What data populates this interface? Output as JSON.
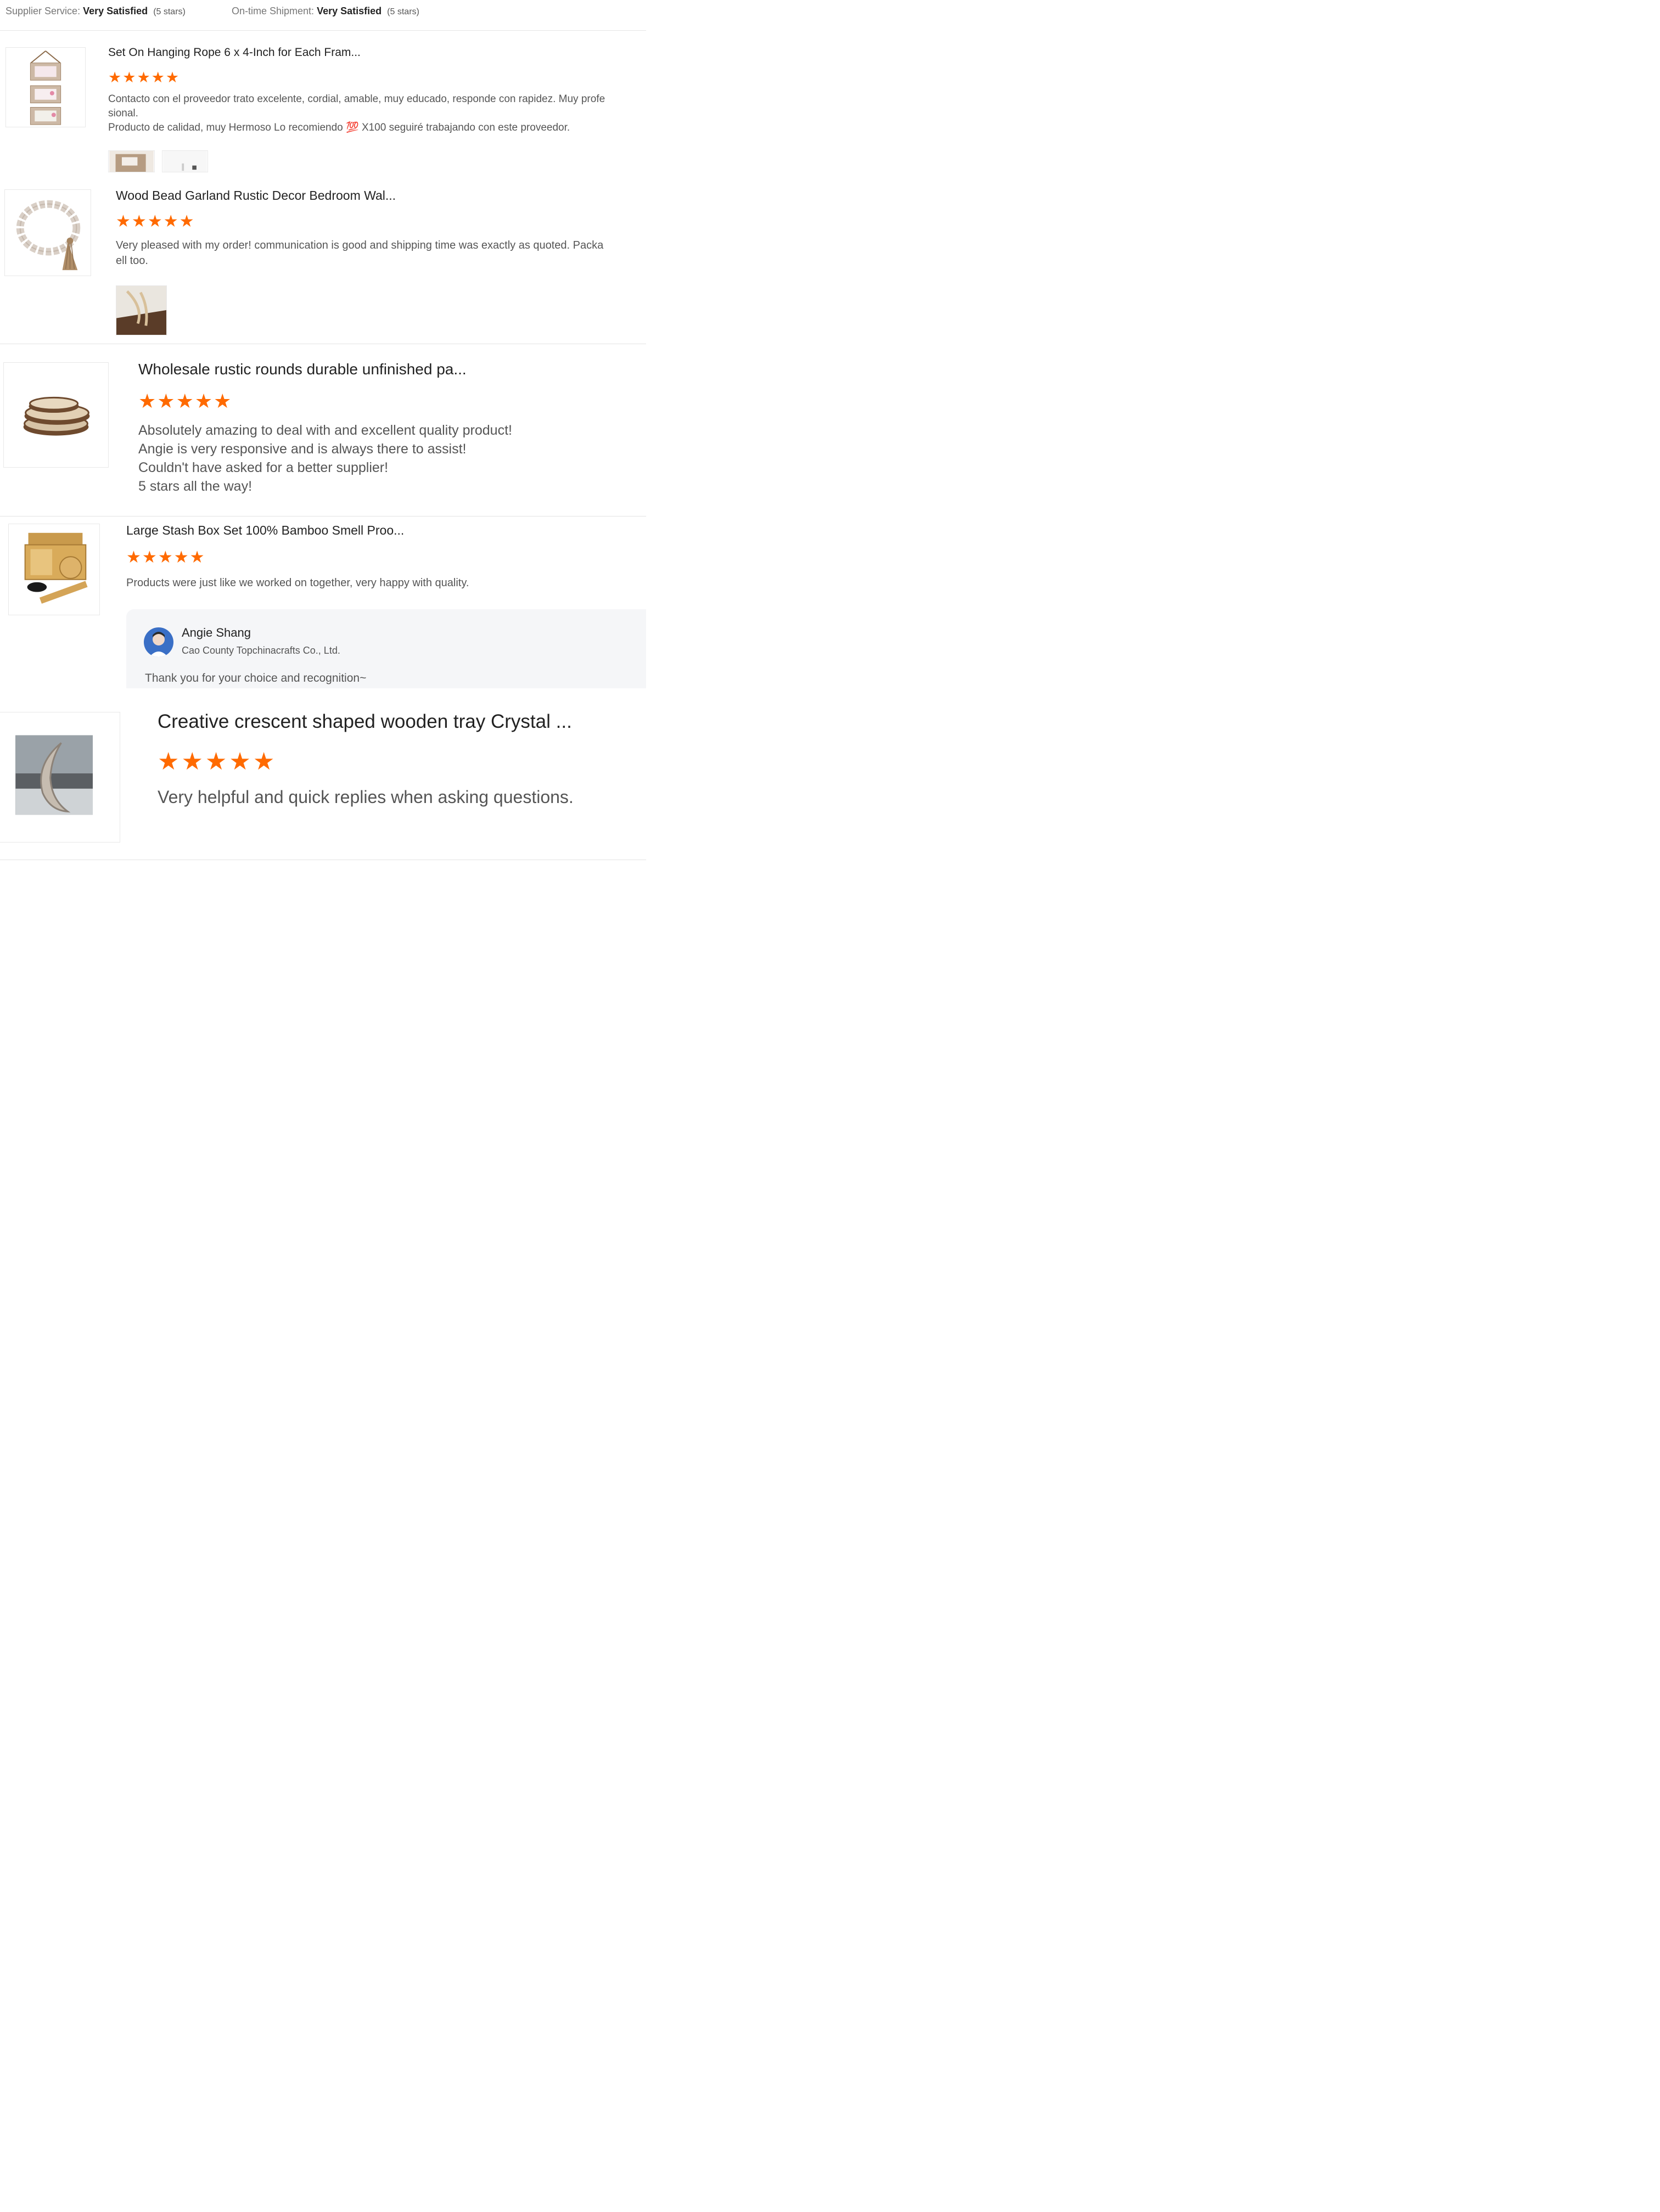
{
  "header": {
    "supplier_service": {
      "label": "Supplier Service:",
      "value": "Very Satisfied",
      "count": "(5 stars)"
    },
    "on_time_shipment": {
      "label": "On-time Shipment:",
      "value": "Very Satisfied",
      "count": "(5 stars)"
    }
  },
  "reviews": [
    {
      "product_title": "Set On Hanging Rope 6 x 4-Inch for Each Fram...",
      "rating": 5,
      "text_lines": [
        "Contacto con el proveedor trato excelente, cordial, amable, muy educado, responde con rapidez. Muy profe",
        "sional.",
        "Producto de calidad, muy Hermoso Lo recomiendo 💯 X100   seguiré trabajando con este proveedor."
      ],
      "photos": 2
    },
    {
      "product_title": "Wood Bead Garland Rustic Decor Bedroom Wal...",
      "rating": 5,
      "text_lines": [
        "Very pleased with my order! communication is good and shipping time was exactly as quoted. Packa",
        "ell too."
      ],
      "photos": 1
    },
    {
      "product_title": "Wholesale rustic rounds durable unfinished pa...",
      "rating": 5,
      "text_lines": [
        "Absolutely amazing to deal with and excellent quality product!",
        "Angie is very responsive and is always there to assist!",
        "Couldn't have asked for a better supplier!",
        "5 stars all the way!"
      ]
    },
    {
      "product_title": "Large Stash Box Set 100% Bamboo Smell Proo...",
      "rating": 5,
      "text_lines": [
        "Products were just like we worked on together, very happy with quality."
      ],
      "reply": {
        "name": "Angie Shang",
        "company": "Cao County Topchinacrafts Co., Ltd.",
        "message": "Thank you for your choice and recognition~"
      }
    },
    {
      "product_title": "Creative crescent shaped wooden tray Crystal ...",
      "rating": 5,
      "text_lines": [
        "Very helpful and quick replies when asking questions."
      ]
    }
  ],
  "colors": {
    "star": "#ff6a00",
    "reply_bg": "#f5f6f8",
    "divider": "#e4e4e4"
  },
  "icons": {
    "rating": "star-icon"
  }
}
